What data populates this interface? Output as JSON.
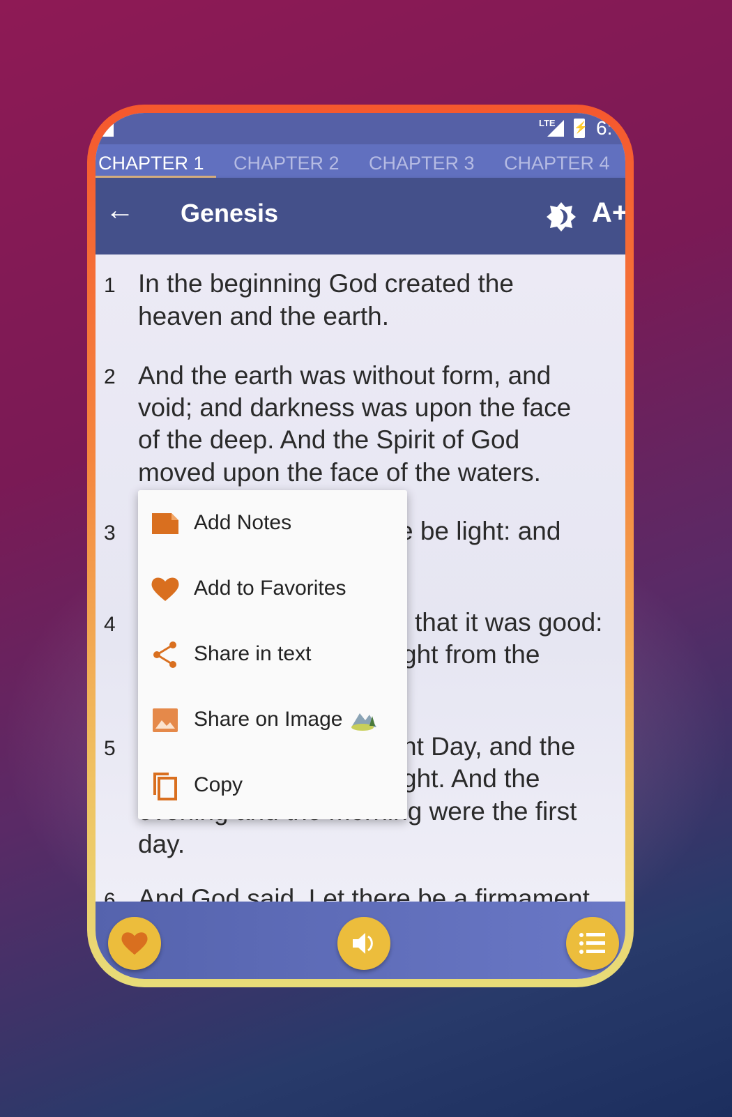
{
  "status_bar": {
    "network": "LTE",
    "time": "6:"
  },
  "tabs": [
    {
      "label": "CHAPTER 1",
      "active": true
    },
    {
      "label": "CHAPTER 2"
    },
    {
      "label": "CHAPTER 3"
    },
    {
      "label": "CHAPTER 4"
    }
  ],
  "toolbar": {
    "title": "Genesis",
    "font_size_label": "A+",
    "back_icon": "arrow-left-icon",
    "brightness_icon": "brightness-icon"
  },
  "verses": [
    {
      "number": "1",
      "lines": [
        "In the beginning God created the",
        "heaven and the earth."
      ]
    },
    {
      "number": "2",
      "lines": [
        "And the earth was without form, and",
        "void; and darkness was upon the face",
        "of the deep. And the Spirit of God",
        "moved upon the face of the waters."
      ]
    },
    {
      "number": "3",
      "lines": [
        "e be light: and"
      ]
    },
    {
      "number": "4",
      "lines": [
        "that it was good:",
        "ght from the"
      ]
    },
    {
      "number": "5",
      "lines": [
        "nt Day, and the",
        "ght. And the",
        "evening and the morning were the first",
        "day."
      ]
    },
    {
      "number": "6",
      "lines": [
        "And God said, Let there be a firmament"
      ]
    }
  ],
  "context_menu": [
    {
      "label": "Add Notes",
      "icon": "note-icon"
    },
    {
      "label": "Add to Favorites",
      "icon": "heart-icon"
    },
    {
      "label": "Share in text",
      "icon": "share-icon"
    },
    {
      "label": "Share on Image",
      "icon": "image-icon"
    },
    {
      "label": "Copy",
      "icon": "copy-icon"
    }
  ],
  "bottom_bar": {
    "favorite_icon": "heart-icon",
    "audio_icon": "speaker-icon",
    "list_icon": "list-icon"
  },
  "colors": {
    "accent": "#d96f1f",
    "fab": "#ecbd3c",
    "toolbar": "#44508a",
    "tabs": "#6170bf"
  }
}
